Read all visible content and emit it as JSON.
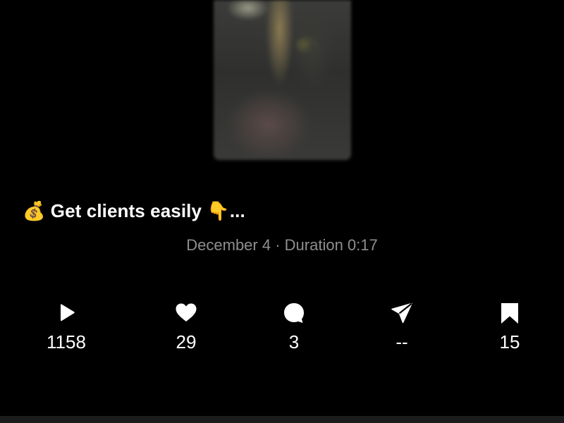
{
  "post": {
    "caption": "💰 Get clients easily 👇...",
    "meta": "December 4 · Duration 0:17"
  },
  "stats": {
    "plays": "1158",
    "likes": "29",
    "comments": "3",
    "shares": "--",
    "saves": "15"
  },
  "icons": {
    "plays": "play-icon",
    "likes": "heart-icon",
    "comments": "comment-icon",
    "shares": "share-icon",
    "saves": "bookmark-icon"
  }
}
